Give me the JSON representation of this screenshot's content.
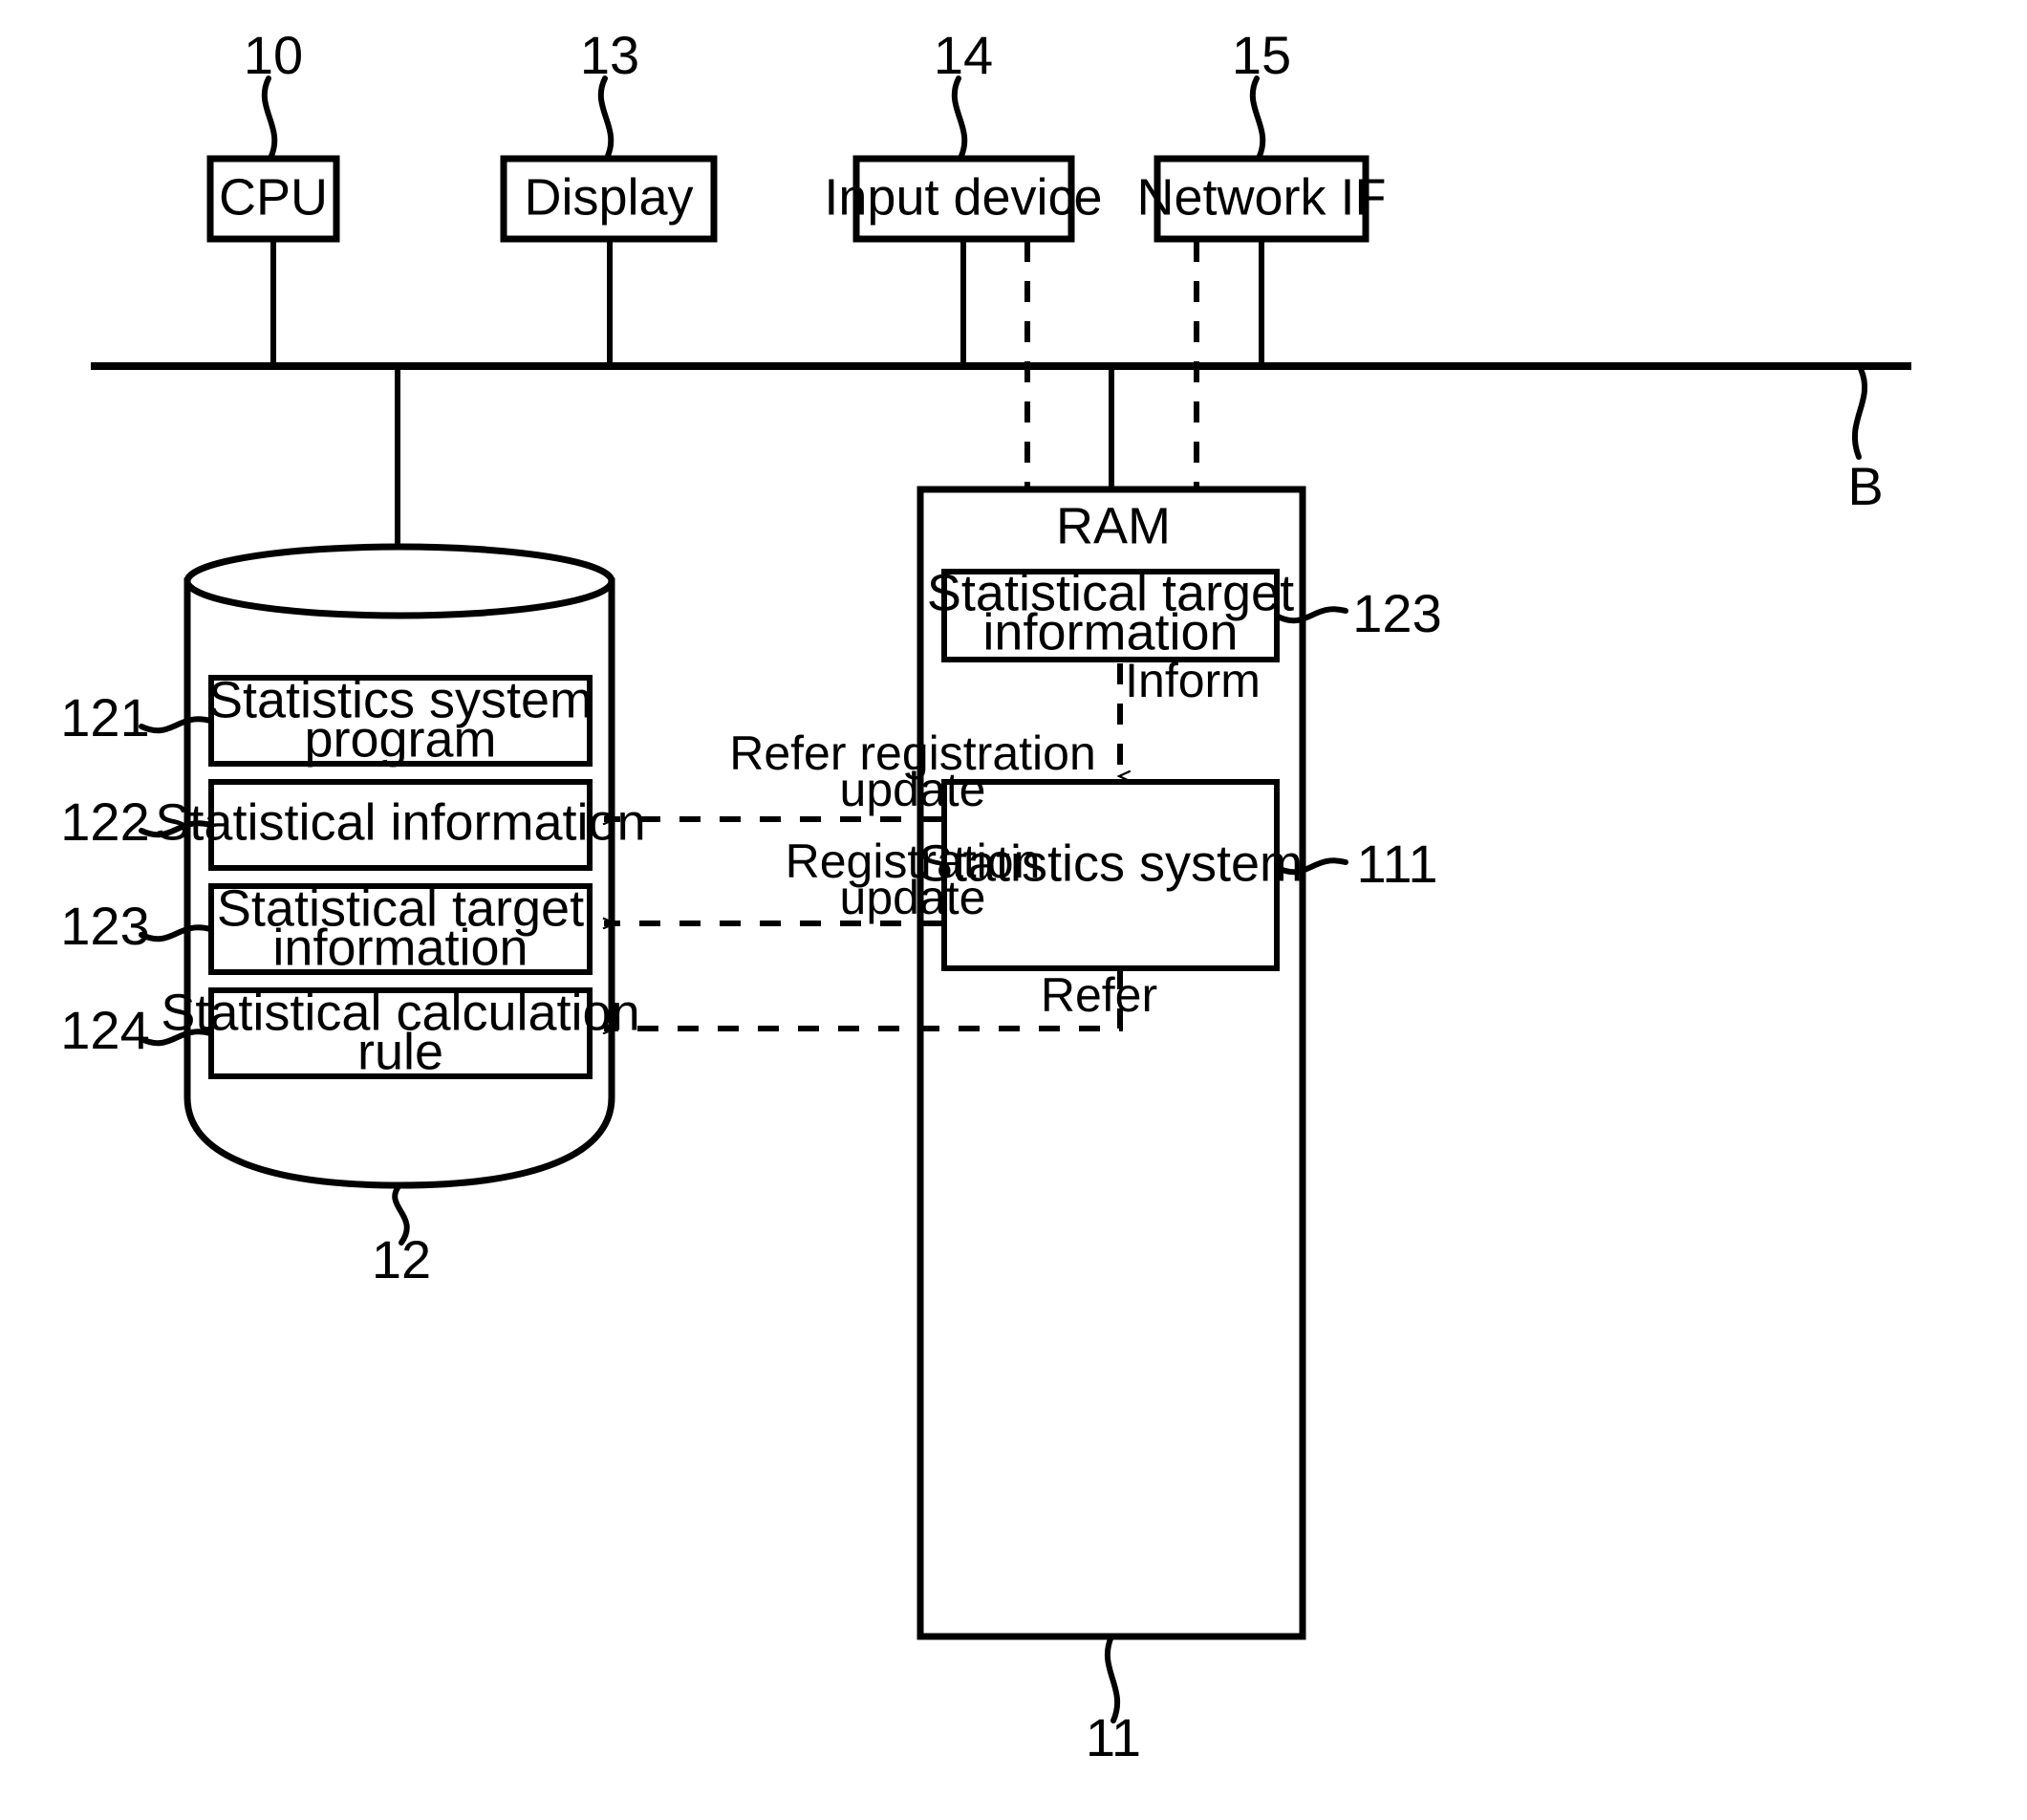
{
  "figure": {
    "type": "patent-block-diagram",
    "bus_label": "B"
  },
  "top_components": [
    {
      "ref": "10",
      "label": "CPU"
    },
    {
      "ref": "13",
      "label": "Display"
    },
    {
      "ref": "14",
      "label": "Input device"
    },
    {
      "ref": "15",
      "label": "Network IF"
    }
  ],
  "storage": {
    "ref": "12",
    "items": [
      {
        "ref": "121",
        "label_line1": "Statistics system",
        "label_line2": "program"
      },
      {
        "ref": "122",
        "label_line1": "Statistical information",
        "label_line2": ""
      },
      {
        "ref": "123",
        "label_line1": "Statistical target",
        "label_line2": "information"
      },
      {
        "ref": "124",
        "label_line1": "Statistical calculation",
        "label_line2": "rule"
      }
    ]
  },
  "ram": {
    "ref": "11",
    "title": "RAM",
    "blocks": [
      {
        "ref": "123",
        "label_line1": "Statistical target",
        "label_line2": "information"
      },
      {
        "ref": "111",
        "label_line1": "Statistics system",
        "label_line2": ""
      }
    ]
  },
  "flows": [
    {
      "id": "inform",
      "label_line1": "Inform",
      "label_line2": ""
    },
    {
      "id": "refer-registration-update",
      "label_line1": "Refer registration",
      "label_line2": "update"
    },
    {
      "id": "registration-update",
      "label_line1": "Registration",
      "label_line2": "update"
    },
    {
      "id": "refer",
      "label_line1": "Refer",
      "label_line2": ""
    }
  ]
}
